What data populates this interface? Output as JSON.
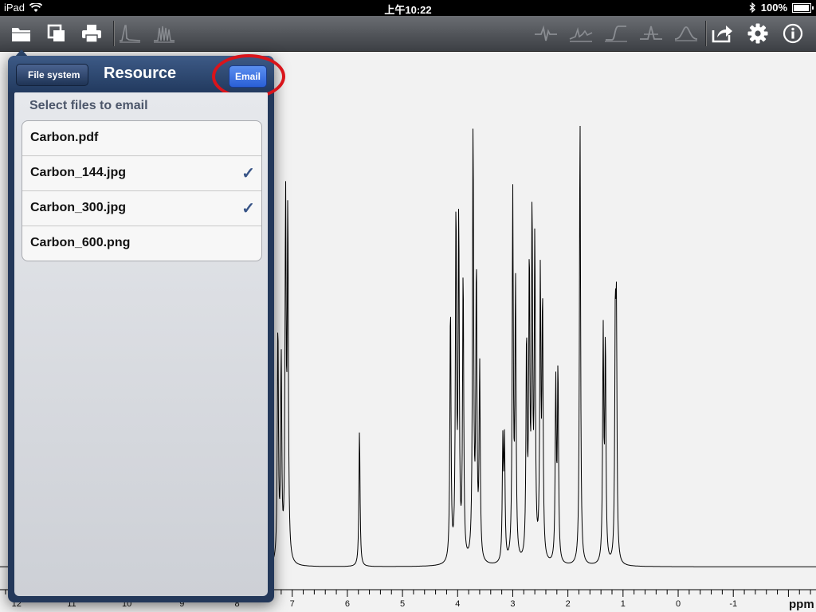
{
  "status_bar": {
    "device": "iPad",
    "time": "上午10:22",
    "battery": "100%",
    "battery_level": 1.0
  },
  "toolbar": {
    "left_icons": [
      "folder-icon",
      "copy-icon",
      "print-icon",
      "peak-icon",
      "multiplet-icon"
    ],
    "right_icons": [
      "phase-icon",
      "baseline-icon",
      "integrate-icon",
      "peak-pick-icon",
      "fit-icon",
      "share-icon",
      "settings-icon",
      "info-icon"
    ]
  },
  "popover": {
    "back_label": "File system",
    "title": "Resource",
    "email_label": "Email",
    "section_title": "Select files to email",
    "files": [
      {
        "name": "Carbon.pdf",
        "checked": false
      },
      {
        "name": "Carbon_144.jpg",
        "checked": true
      },
      {
        "name": "Carbon_300.jpg",
        "checked": true
      },
      {
        "name": "Carbon_600.png",
        "checked": false
      }
    ],
    "check_mark": "✓"
  },
  "chart_data": {
    "type": "line",
    "xlabel": "ppm",
    "xlim": [
      12.3,
      -2.5
    ],
    "x_reversed": true,
    "ticks": [
      12,
      11,
      10,
      9,
      8,
      7,
      6,
      5,
      4,
      3,
      2,
      1,
      0,
      -1
    ],
    "tick_labels": [
      "12",
      "11",
      "10",
      "9",
      "8",
      "7",
      "6",
      "5",
      "4",
      "3",
      "2",
      "1",
      "0",
      "-1"
    ],
    "ylim": [
      0,
      1
    ],
    "baseline": 0.042,
    "peaks": [
      {
        "ppm": 7.26,
        "height": 0.47
      },
      {
        "ppm": 7.2,
        "height": 0.4
      },
      {
        "ppm": 7.12,
        "height": 0.7
      },
      {
        "ppm": 7.08,
        "height": 0.68
      },
      {
        "ppm": 5.78,
        "height": 0.27
      },
      {
        "ppm": 4.13,
        "height": 0.51
      },
      {
        "ppm": 4.03,
        "height": 0.69
      },
      {
        "ppm": 3.98,
        "height": 0.67
      },
      {
        "ppm": 3.9,
        "height": 0.57
      },
      {
        "ppm": 3.72,
        "height": 0.86
      },
      {
        "ppm": 3.66,
        "height": 0.57
      },
      {
        "ppm": 3.6,
        "height": 0.38
      },
      {
        "ppm": 3.18,
        "height": 0.23
      },
      {
        "ppm": 3.15,
        "height": 0.23
      },
      {
        "ppm": 3.0,
        "height": 0.72
      },
      {
        "ppm": 2.95,
        "height": 0.54
      },
      {
        "ppm": 2.75,
        "height": 0.43
      },
      {
        "ppm": 2.7,
        "height": 0.57
      },
      {
        "ppm": 2.65,
        "height": 0.67
      },
      {
        "ppm": 2.6,
        "height": 0.62
      },
      {
        "ppm": 2.5,
        "height": 0.55
      },
      {
        "ppm": 2.46,
        "height": 0.5
      },
      {
        "ppm": 2.22,
        "height": 0.35
      },
      {
        "ppm": 2.18,
        "height": 0.38
      },
      {
        "ppm": 1.78,
        "height": 0.89
      },
      {
        "ppm": 1.36,
        "height": 0.45
      },
      {
        "ppm": 1.32,
        "height": 0.43
      },
      {
        "ppm": 1.14,
        "height": 0.44
      },
      {
        "ppm": 1.12,
        "height": 0.44
      }
    ]
  }
}
